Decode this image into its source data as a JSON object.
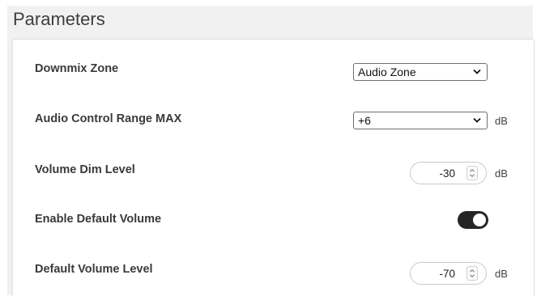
{
  "panel": {
    "title": "Parameters"
  },
  "rows": [
    {
      "label": "Downmix Zone",
      "control": "select",
      "value": "Audio Zone",
      "unit": ""
    },
    {
      "label": "Audio Control Range MAX",
      "control": "select",
      "value": "+6",
      "unit": "dB"
    },
    {
      "label": "Volume Dim Level",
      "control": "stepper",
      "value": "-30",
      "unit": "dB"
    },
    {
      "label": "Enable Default Volume",
      "control": "toggle",
      "value": "on",
      "unit": ""
    },
    {
      "label": "Default Volume Level",
      "control": "stepper",
      "value": "-70",
      "unit": "dB"
    }
  ],
  "colors": {
    "panel_bg": "#f1f1f1",
    "card_bg": "#ffffff",
    "toggle_on": "#262626"
  },
  "icons": {
    "select_arrow": "chevron-down-icon",
    "stepper_arrows": "spin-up-down-icon"
  }
}
